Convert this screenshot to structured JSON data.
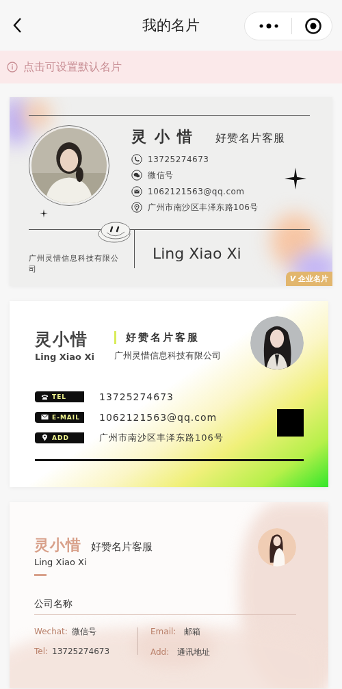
{
  "nav": {
    "title": "我的名片"
  },
  "notice": {
    "text": "点击可设置默认名片"
  },
  "cards": [
    {
      "kind": "classic",
      "name": "灵 小 惜",
      "title": "好赞名片客服",
      "contacts": [
        {
          "kind": "phone",
          "text": "13725274673"
        },
        {
          "kind": "wechat",
          "text": "微信号"
        },
        {
          "kind": "mail",
          "text": "1062121563@qq.com"
        },
        {
          "kind": "location",
          "text": "广州市南沙区丰泽东路106号"
        }
      ],
      "company": "广州灵惜信息科技有限公司",
      "name_en": "Ling Xiao Xi",
      "badge_mark": "V",
      "badge": "企业名片"
    },
    {
      "kind": "green",
      "name": "灵小惜",
      "name_en": "Ling Xiao Xi",
      "title": "好赞名片客服",
      "company": "广州灵惜信息科技有限公司",
      "contacts": [
        {
          "kind": "phone",
          "label": "TEL",
          "text": "13725274673"
        },
        {
          "kind": "mail",
          "label": "E-MAIL",
          "text": "1062121563@qq.com"
        },
        {
          "kind": "location",
          "label": "ADD",
          "text": "广州市南沙区丰泽东路106号"
        }
      ]
    },
    {
      "kind": "rose",
      "name": "灵小惜",
      "title": "好赞名片客服",
      "name_en": "Ling Xiao Xi",
      "company": "公司名称",
      "fields": [
        {
          "label": "Wechat:",
          "value": "微信号"
        },
        {
          "label": "Email:",
          "value": "邮箱"
        },
        {
          "label": "Tel:",
          "value": "13725274673"
        },
        {
          "label": "Add:",
          "value": "通讯地址"
        }
      ]
    }
  ]
}
